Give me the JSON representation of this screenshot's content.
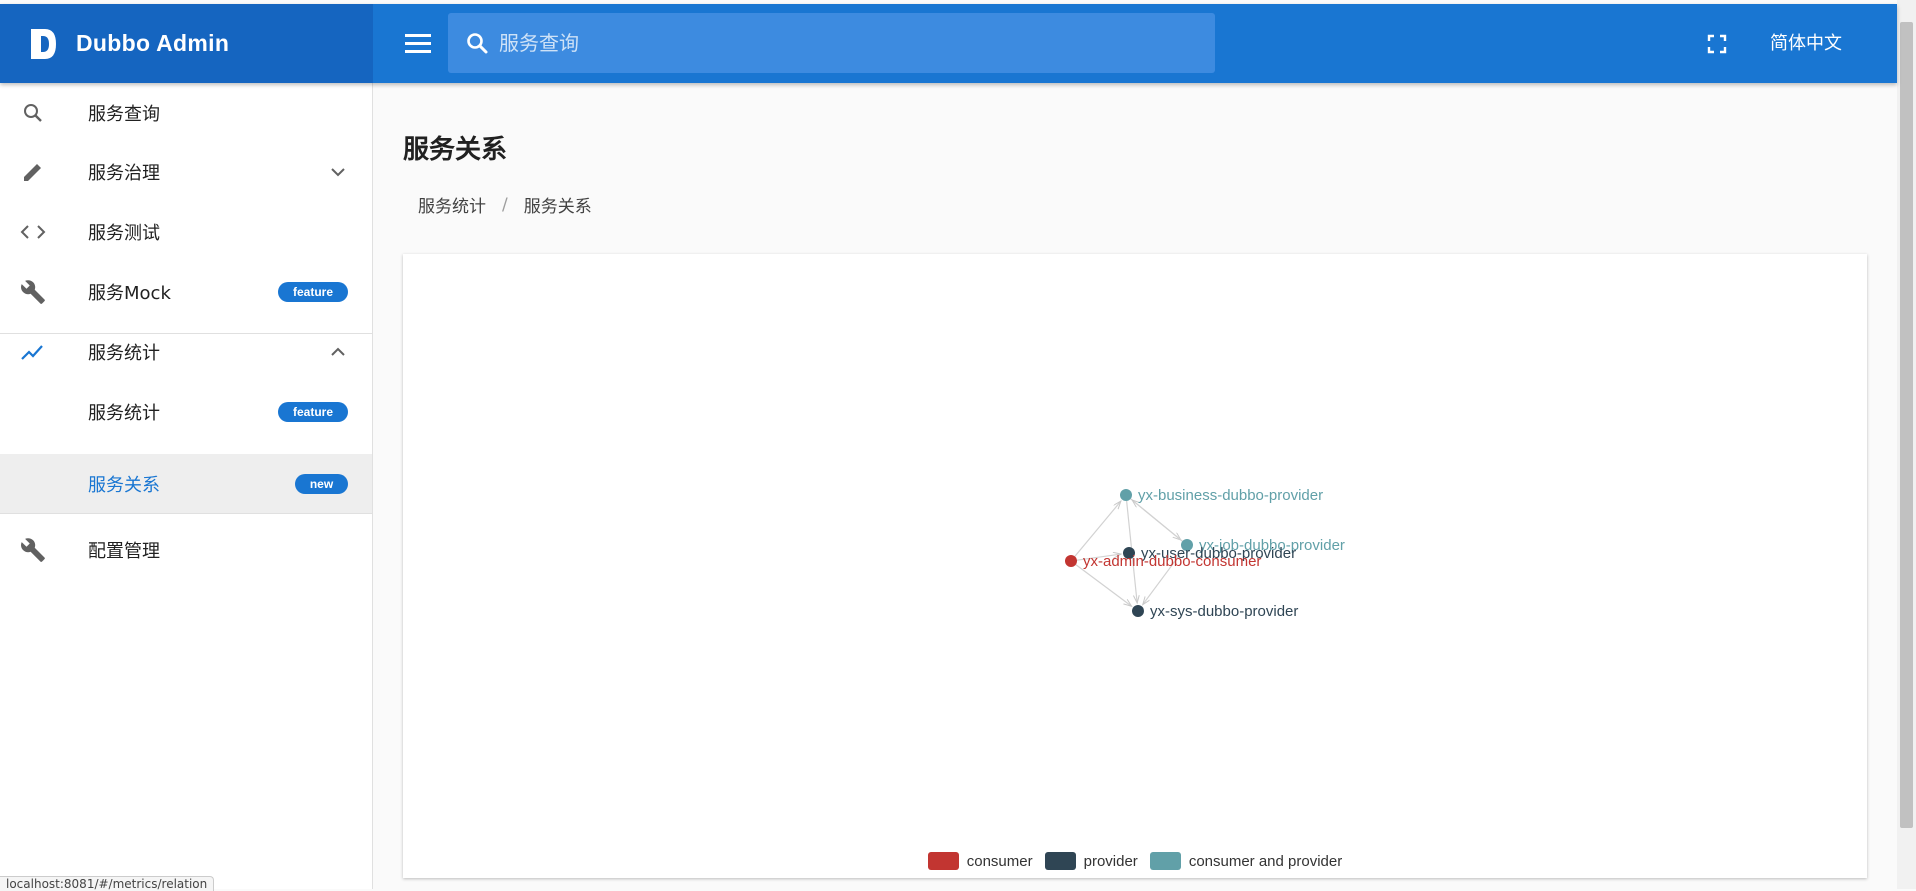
{
  "app": {
    "title": "Dubbo Admin",
    "logo_letter": "D"
  },
  "header": {
    "search_placeholder": "服务查询",
    "language": "简体中文"
  },
  "sidebar": {
    "items": [
      {
        "label": "服务查询",
        "icon": "search-icon"
      },
      {
        "label": "服务治理",
        "icon": "pencil-icon",
        "expand": "chevron-down-icon"
      },
      {
        "label": "服务测试",
        "icon": "code-icon"
      },
      {
        "label": "服务Mock",
        "icon": "wrench-icon",
        "badge": "feature"
      },
      {
        "label": "服务统计",
        "icon": "trending-up-icon",
        "expand": "chevron-up-icon"
      },
      {
        "label": "服务统计",
        "badge": "feature"
      },
      {
        "label": "服务关系",
        "badge": "new",
        "active": true
      },
      {
        "label": "配置管理",
        "icon": "wrench-icon"
      }
    ]
  },
  "page": {
    "title": "服务关系",
    "breadcrumb": [
      "服务统计",
      "服务关系"
    ]
  },
  "status_url": "localhost:8081/#/metrics/relation",
  "colors": {
    "primary": "#1976d2",
    "consumer": "#c23531",
    "provider": "#2f4554",
    "consumer_and_provider": "#61a0a8"
  },
  "chart_data": {
    "type": "graph",
    "categories": [
      "consumer",
      "provider",
      "consumer and provider"
    ],
    "nodes": [
      {
        "name": "yx-business-dubbo-provider",
        "category": "consumer and provider"
      },
      {
        "name": "yx-job-dubbo-provider",
        "category": "consumer and provider"
      },
      {
        "name": "yx-user-dubbo-provider",
        "category": "provider"
      },
      {
        "name": "yx-admin-dubbo-consumer",
        "category": "consumer"
      },
      {
        "name": "yx-sys-dubbo-provider",
        "category": "provider"
      }
    ],
    "links": [
      {
        "source": "yx-admin-dubbo-consumer",
        "target": "yx-business-dubbo-provider"
      },
      {
        "source": "yx-admin-dubbo-consumer",
        "target": "yx-user-dubbo-provider"
      },
      {
        "source": "yx-admin-dubbo-consumer",
        "target": "yx-sys-dubbo-provider"
      },
      {
        "source": "yx-business-dubbo-provider",
        "target": "yx-job-dubbo-provider"
      },
      {
        "source": "yx-business-dubbo-provider",
        "target": "yx-sys-dubbo-provider"
      },
      {
        "source": "yx-job-dubbo-provider",
        "target": "yx-sys-dubbo-provider"
      },
      {
        "source": "yx-job-dubbo-provider",
        "target": "yx-business-dubbo-provider"
      }
    ],
    "legend": [
      "consumer",
      "provider",
      "consumer and provider"
    ],
    "legend_position": "bottom-center"
  }
}
